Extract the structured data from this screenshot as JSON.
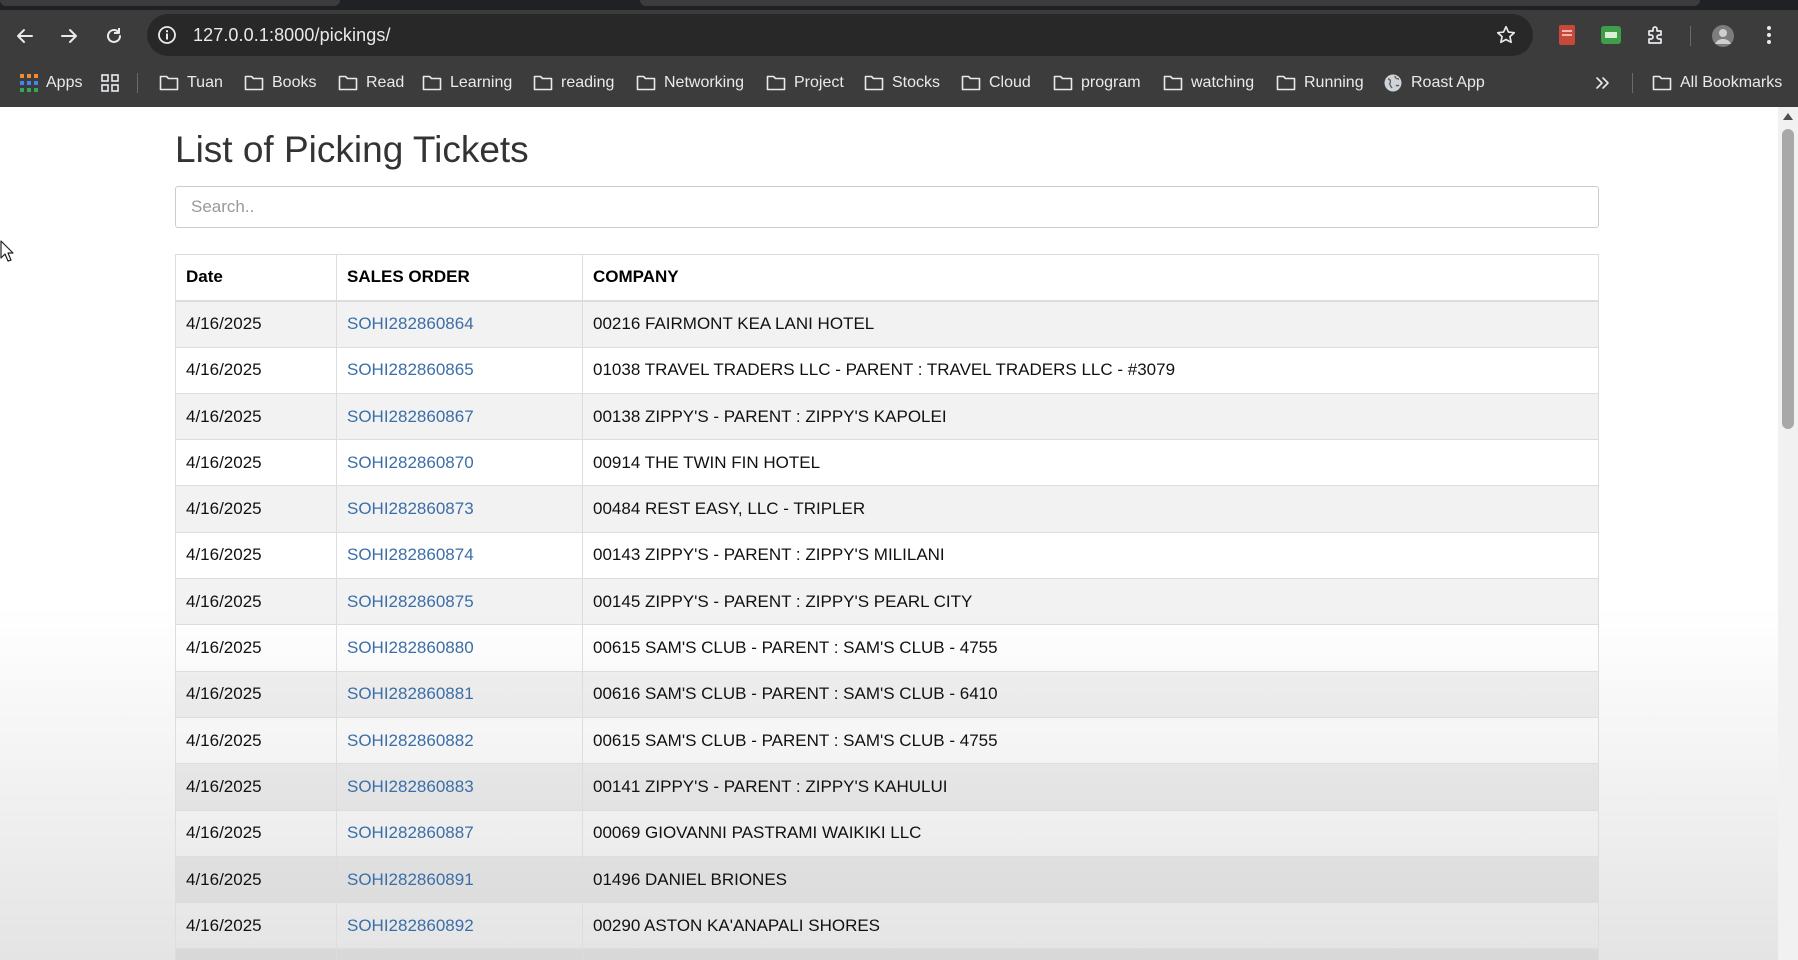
{
  "browser": {
    "url": "127.0.0.1:8000/pickings/",
    "bookmarks": [
      {
        "label": "Apps",
        "icon": "apps-grid-icon"
      },
      {
        "label": "Tuan",
        "icon": "folder-icon"
      },
      {
        "label": "Books",
        "icon": "folder-icon"
      },
      {
        "label": "Read",
        "icon": "folder-icon"
      },
      {
        "label": "Learning",
        "icon": "folder-icon"
      },
      {
        "label": "reading",
        "icon": "folder-icon"
      },
      {
        "label": "Networking",
        "icon": "folder-icon"
      },
      {
        "label": "Project",
        "icon": "folder-icon"
      },
      {
        "label": "Stocks",
        "icon": "folder-icon"
      },
      {
        "label": "Cloud",
        "icon": "folder-icon"
      },
      {
        "label": "program",
        "icon": "folder-icon"
      },
      {
        "label": "watching",
        "icon": "folder-icon"
      },
      {
        "label": "Running",
        "icon": "folder-icon"
      },
      {
        "label": "Roast App",
        "icon": "globe-icon"
      }
    ],
    "all_bookmarks_label": "All Bookmarks"
  },
  "page": {
    "title": "List of Picking Tickets",
    "search_placeholder": "Search..",
    "columns": [
      "Date",
      "SALES ORDER",
      "COMPANY"
    ],
    "rows": [
      {
        "date": "4/16/2025",
        "sales_order": "SOHI282860864",
        "company": "00216 FAIRMONT KEA LANI HOTEL"
      },
      {
        "date": "4/16/2025",
        "sales_order": "SOHI282860865",
        "company": "01038 TRAVEL TRADERS LLC - PARENT : TRAVEL TRADERS LLC - #3079"
      },
      {
        "date": "4/16/2025",
        "sales_order": "SOHI282860867",
        "company": "00138 ZIPPY'S - PARENT : ZIPPY'S KAPOLEI"
      },
      {
        "date": "4/16/2025",
        "sales_order": "SOHI282860870",
        "company": "00914 THE TWIN FIN HOTEL"
      },
      {
        "date": "4/16/2025",
        "sales_order": "SOHI282860873",
        "company": "00484 REST EASY, LLC - TRIPLER"
      },
      {
        "date": "4/16/2025",
        "sales_order": "SOHI282860874",
        "company": "00143 ZIPPY'S - PARENT : ZIPPY'S MILILANI"
      },
      {
        "date": "4/16/2025",
        "sales_order": "SOHI282860875",
        "company": "00145 ZIPPY'S - PARENT : ZIPPY'S PEARL CITY"
      },
      {
        "date": "4/16/2025",
        "sales_order": "SOHI282860880",
        "company": "00615 SAM'S CLUB - PARENT : SAM'S CLUB - 4755"
      },
      {
        "date": "4/16/2025",
        "sales_order": "SOHI282860881",
        "company": "00616 SAM'S CLUB - PARENT : SAM'S CLUB - 6410"
      },
      {
        "date": "4/16/2025",
        "sales_order": "SOHI282860882",
        "company": "00615 SAM'S CLUB - PARENT : SAM'S CLUB - 4755"
      },
      {
        "date": "4/16/2025",
        "sales_order": "SOHI282860883",
        "company": "00141 ZIPPY'S - PARENT : ZIPPY'S KAHULUI"
      },
      {
        "date": "4/16/2025",
        "sales_order": "SOHI282860887",
        "company": "00069 GIOVANNI PASTRAMI WAIKIKI LLC"
      },
      {
        "date": "4/16/2025",
        "sales_order": "SOHI282860891",
        "company": "01496 DANIEL BRIONES"
      },
      {
        "date": "4/16/2025",
        "sales_order": "SOHI282860892",
        "company": "00290 ASTON KA'ANAPALI SHORES"
      },
      {
        "date": "",
        "sales_order": "",
        "company": ""
      }
    ]
  },
  "colors": {
    "link": "#3b6ea8",
    "chrome_bg": "#3c3c3c",
    "omnibox_bg": "#282828"
  }
}
